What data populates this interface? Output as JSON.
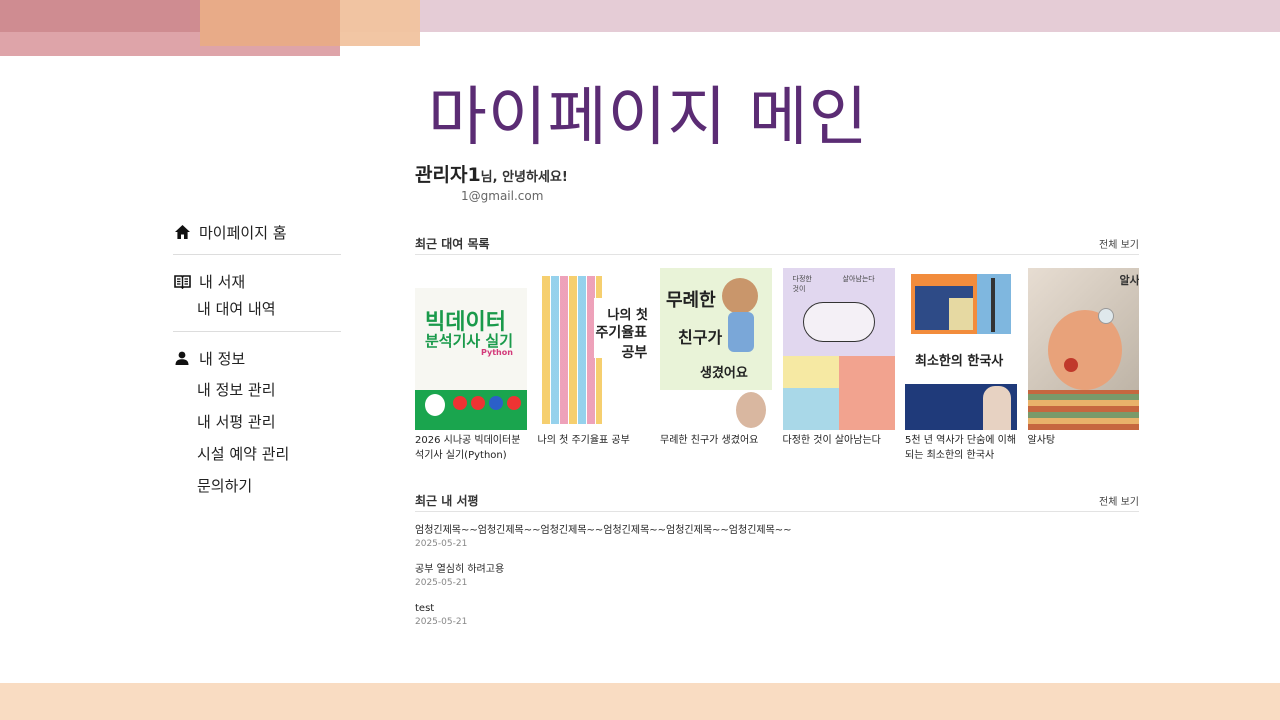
{
  "page": {
    "title": "마이페이지 메인"
  },
  "user": {
    "name": "관리자1",
    "greeting_suffix": "님, 안녕하세요!",
    "email": "1@gmail.com"
  },
  "sidebar": {
    "home": "마이페이지 홈",
    "library": {
      "label": "내 서재",
      "items": [
        "내 대여 내역"
      ]
    },
    "info": {
      "label": "내 정보",
      "items": [
        "내 정보 관리",
        "내 서평 관리",
        "시설 예약 관리",
        "문의하기"
      ]
    }
  },
  "rentals": {
    "title": "최근 대여 목록",
    "more": "전체 보기",
    "books": [
      {
        "title": "2026 시나공 빅데이터분석기사 실기(Python)",
        "cover_text": [
          "빅데이터",
          "분석기사 실기",
          "Python"
        ]
      },
      {
        "title": "나의 첫 주기율표 공부",
        "cover_text": [
          "나의 첫",
          "주기율표",
          "공부"
        ]
      },
      {
        "title": "무례한 친구가 생겼어요",
        "cover_text": [
          "무례한",
          "친구가",
          "생겼어요"
        ]
      },
      {
        "title": "다정한 것이 살아남는다",
        "cover_text": [
          "다정한",
          "것이",
          "살아남는다"
        ]
      },
      {
        "title": "5천 년 역사가 단숨에 이해되는 최소한의 한국사",
        "cover_text": [
          "최소한의 한국사"
        ]
      },
      {
        "title": "알사탕",
        "cover_text": [
          "알사탕"
        ]
      }
    ]
  },
  "reviews": {
    "title": "최근 내 서평",
    "more": "전체 보기",
    "items": [
      {
        "title": "엄청긴제목~~엄청긴제목~~엄청긴제목~~엄청긴제목~~엄청긴제목~~엄청긴제목~~",
        "date": "2025-05-21"
      },
      {
        "title": "공부 열심히 하려고용",
        "date": "2025-05-21"
      },
      {
        "title": "test",
        "date": "2025-05-21"
      }
    ]
  },
  "colors": {
    "title": "#5b2c74",
    "deco_rose": "#dea4a9",
    "deco_peach": "#f1c39f",
    "deco_top": "#e5ccd6",
    "deco_bottom": "#f9dcc2"
  },
  "icons": {
    "home": "home-icon",
    "library": "book-open-icon",
    "info": "person-icon"
  }
}
